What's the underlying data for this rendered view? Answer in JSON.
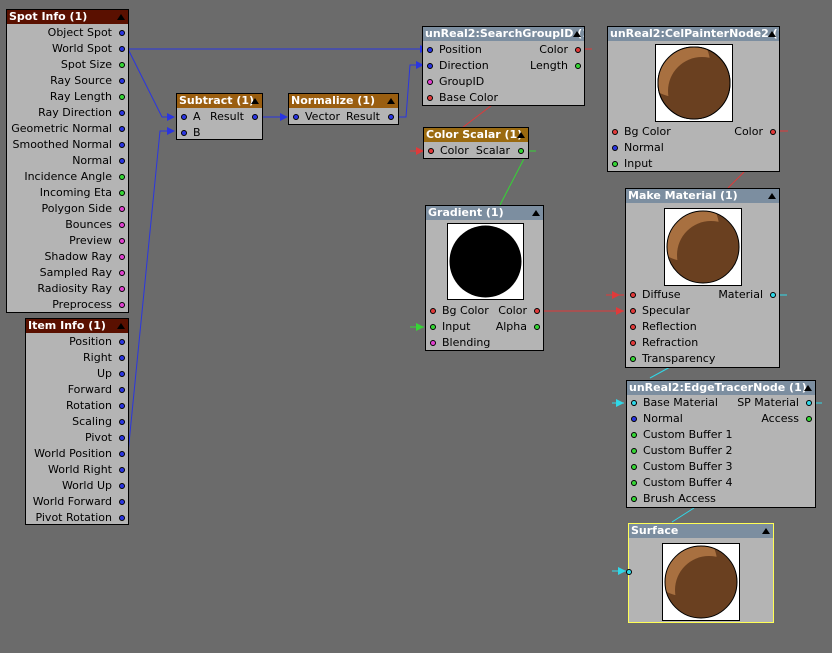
{
  "spot_info": {
    "title": "Spot Info (1)",
    "outputs": [
      "Object Spot",
      "World Spot",
      "Spot Size",
      "Ray Source",
      "Ray Length",
      "Ray Direction",
      "Geometric Normal",
      "Smoothed Normal",
      "Normal",
      "Incidence Angle",
      "Incoming Eta",
      "Polygon Side",
      "Bounces",
      "Preview",
      "Shadow Ray",
      "Sampled Ray",
      "Radiosity Ray",
      "Preprocess"
    ]
  },
  "item_info": {
    "title": "Item Info (1)",
    "outputs": [
      "Position",
      "Right",
      "Up",
      "Forward",
      "Rotation",
      "Scaling",
      "Pivot",
      "World Position",
      "World Right",
      "World Up",
      "World Forward",
      "Pivot Rotation"
    ]
  },
  "subtract": {
    "title": "Subtract (1)",
    "input_a": "A",
    "input_b": "B",
    "output": "Result"
  },
  "normalize": {
    "title": "Normalize (1)",
    "input": "Vector",
    "output": "Result"
  },
  "search_group": {
    "title": "unReal2:SearchGroupID (1)",
    "inputs": [
      "Position",
      "Direction",
      "GroupID",
      "Base Color"
    ],
    "outputs": [
      "Color",
      "Length"
    ]
  },
  "color_scalar": {
    "title": "Color Scalar (1)",
    "input": "Color",
    "output": "Scalar"
  },
  "gradient": {
    "title": "Gradient (1)",
    "inputs": [
      "Bg Color",
      "Input",
      "Blending"
    ],
    "outputs": [
      "Color",
      "Alpha"
    ]
  },
  "cel_painter": {
    "title": "unReal2:CelPainterNode2 (1)",
    "inputs": [
      "Bg Color",
      "Normal",
      "Input"
    ],
    "output": "Color"
  },
  "make_material": {
    "title": "Make Material (1)",
    "inputs": [
      "Diffuse",
      "Specular",
      "Reflection",
      "Refraction",
      "Transparency"
    ],
    "output": "Material"
  },
  "edge_tracer": {
    "title": "unReal2:EdgeTracerNode (1)",
    "inputs": [
      "Base Material",
      "Normal",
      "Custom Buffer 1",
      "Custom Buffer 2",
      "Custom Buffer 3",
      "Custom Buffer 4",
      "Brush Access"
    ],
    "outputs": [
      "SP Material",
      "Access"
    ]
  },
  "surface": {
    "title": "Surface"
  },
  "colors": {
    "sphere_light": "#a87040",
    "sphere_dark": "#6a4020",
    "canvas": "#6b6b6b"
  }
}
